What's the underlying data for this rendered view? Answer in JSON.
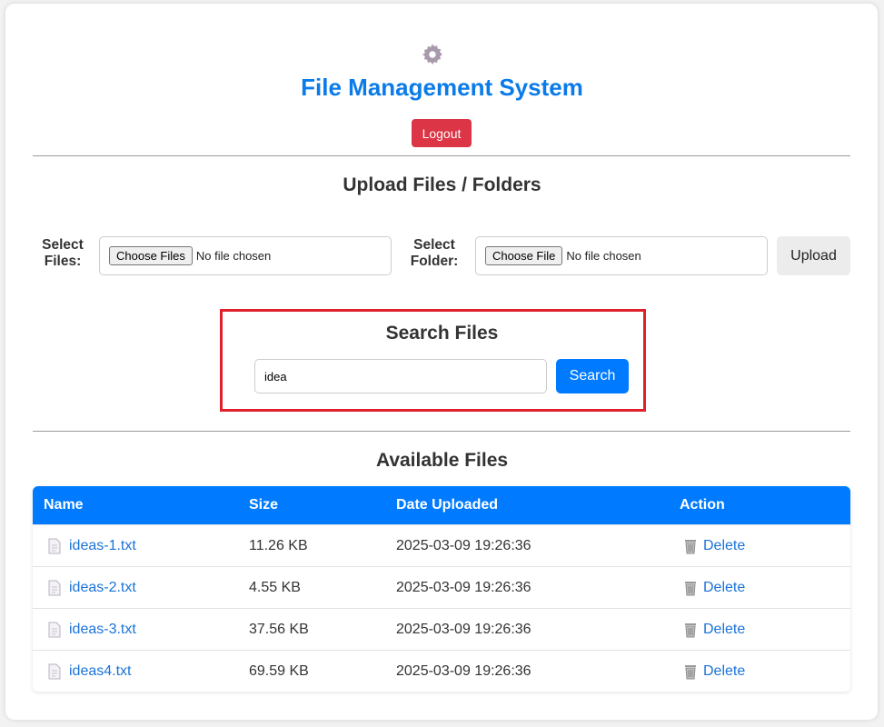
{
  "header": {
    "icon": "gear-icon",
    "title": "File Management System",
    "logout_label": "Logout"
  },
  "upload": {
    "heading": "Upload Files / Folders",
    "files_label_line1": "Select",
    "files_label_line2": "Files:",
    "files_button": "Choose Files",
    "files_status": "No file chosen",
    "folder_label_line1": "Select",
    "folder_label_line2": "Folder:",
    "folder_button": "Choose File",
    "folder_status": "No file chosen",
    "upload_label": "Upload"
  },
  "search": {
    "heading": "Search Files",
    "value": "idea",
    "button_label": "Search"
  },
  "files": {
    "heading": "Available Files",
    "columns": [
      "Name",
      "Size",
      "Date Uploaded",
      "Action"
    ],
    "rows": [
      {
        "name": "ideas-1.txt",
        "size": "11.26 KB",
        "date": "2025-03-09 19:26:36",
        "action": "Delete"
      },
      {
        "name": "ideas-2.txt",
        "size": "4.55 KB",
        "date": "2025-03-09 19:26:36",
        "action": "Delete"
      },
      {
        "name": "ideas-3.txt",
        "size": "37.56 KB",
        "date": "2025-03-09 19:26:36",
        "action": "Delete"
      },
      {
        "name": "ideas4.txt",
        "size": "69.59 KB",
        "date": "2025-03-09 19:26:36",
        "action": "Delete"
      }
    ]
  },
  "colors": {
    "title": "#0a7be8",
    "logout": "#dc3545",
    "primary": "#007bff",
    "highlight_border": "#e0202a",
    "link": "#1a73d9"
  }
}
